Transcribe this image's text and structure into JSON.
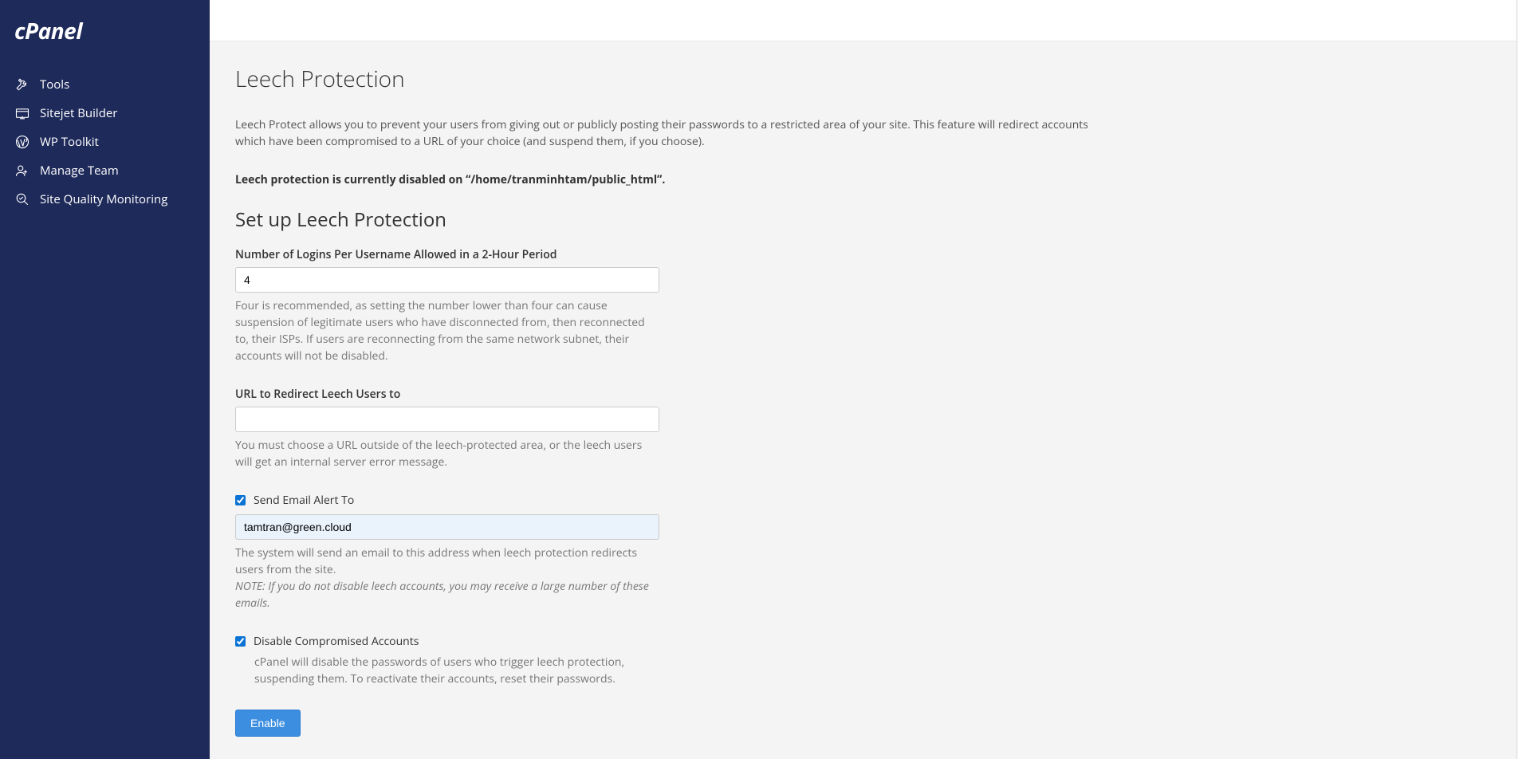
{
  "logo": {
    "text": "cPanel"
  },
  "sidebar": {
    "items": [
      {
        "label": "Tools"
      },
      {
        "label": "Sitejet Builder"
      },
      {
        "label": "WP Toolkit"
      },
      {
        "label": "Manage Team"
      },
      {
        "label": "Site Quality Monitoring"
      }
    ]
  },
  "page": {
    "title": "Leech Protection",
    "intro": "Leech Protect allows you to prevent your users from giving out or publicly posting their passwords to a restricted area of your site. This feature will redirect accounts which have been compromised to a URL of your choice (and suspend them, if you choose).",
    "status": "Leech protection is currently disabled on “/home/tranminhtam/public_html”."
  },
  "setup": {
    "title": "Set up Leech Protection",
    "logins": {
      "label": "Number of Logins Per Username Allowed in a 2-Hour Period",
      "value": "4",
      "help": "Four is recommended, as setting the number lower than four can cause suspension of legitimate users who have disconnected from, then reconnected to, their ISPs. If users are reconnecting from the same network subnet, their accounts will not be disabled."
    },
    "redirect": {
      "label": "URL to Redirect Leech Users to",
      "value": "",
      "help": "You must choose a URL outside of the leech-protected area, or the leech users will get an internal server error message."
    },
    "email": {
      "label": "Send Email Alert To",
      "checked": true,
      "value": "tamtran@green.cloud",
      "help": "The system will send an email to this address when leech protection redirects users from the site.",
      "note": "NOTE: If you do not disable leech accounts, you may receive a large number of these emails."
    },
    "disable": {
      "label": "Disable Compromised Accounts",
      "checked": true,
      "help": "cPanel will disable the passwords of users who trigger leech protection, suspending them. To reactivate their accounts, reset their passwords."
    },
    "button": "Enable"
  }
}
